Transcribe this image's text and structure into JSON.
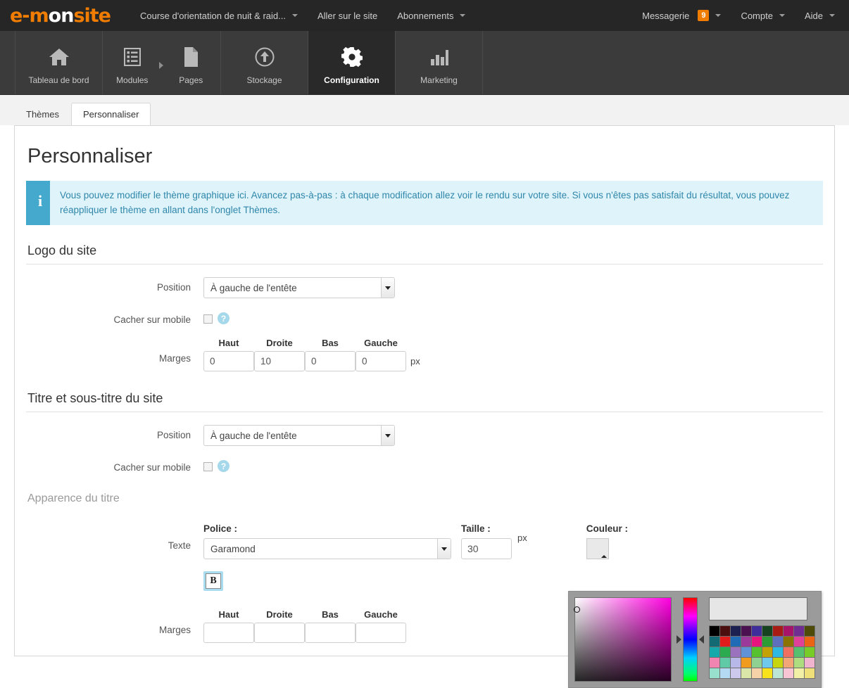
{
  "topbar": {
    "brand_part1": "e-m",
    "brand_part2": "on",
    "brand_part3": "site",
    "nav": [
      {
        "label": "Course d'orientation de nuit & raid...",
        "caret": true
      },
      {
        "label": "Aller sur le site",
        "caret": false
      },
      {
        "label": "Abonnements",
        "caret": true
      }
    ],
    "right": [
      {
        "label": "Messagerie",
        "badge": "9",
        "caret": true
      },
      {
        "label": "Compte",
        "badge": null,
        "caret": true
      },
      {
        "label": "Aide",
        "badge": null,
        "caret": true
      }
    ],
    "badge_color": "#f07d00"
  },
  "mainnav": {
    "items": [
      {
        "label": "Tableau de bord",
        "icon": "home-icon",
        "active": false
      },
      {
        "label": "Modules",
        "icon": "list-icon",
        "active": false
      },
      {
        "label": "Pages",
        "icon": "page-icon",
        "active": false
      },
      {
        "label": "Stockage",
        "icon": "upload-circle-icon",
        "active": false
      },
      {
        "label": "Configuration",
        "icon": "gear-icon",
        "active": true
      },
      {
        "label": "Marketing",
        "icon": "bar-chart-icon",
        "active": false
      }
    ]
  },
  "tabs": [
    {
      "label": "Thèmes",
      "active": false
    },
    {
      "label": "Personnaliser",
      "active": true
    }
  ],
  "page": {
    "title": "Personnaliser"
  },
  "alert": {
    "icon": "info-icon",
    "text": "Vous pouvez modifier le thème graphique ici. Avancez pas-à-pas : à chaque modification allez voir le rendu sur votre site. Si vous n'êtes pas satisfait du résultat, vous pouvez réappliquer le thème en allant dans l'onglet Thèmes.",
    "accent_color": "#44a9cc",
    "bg_color": "#dff3fb",
    "text_color": "#2f87ab"
  },
  "logo_section": {
    "title": "Logo du site",
    "position_label": "Position",
    "position_value": "À gauche de l'entête",
    "hide_mobile_label": "Cacher sur mobile",
    "hide_mobile_checked": false,
    "help_glyph": "?",
    "margins_label": "Marges",
    "margin_heads": [
      "Haut",
      "Droite",
      "Bas",
      "Gauche"
    ],
    "margin_values": [
      "0",
      "10",
      "0",
      "0"
    ],
    "unit": "px"
  },
  "title_section": {
    "title": "Titre et sous-titre du site",
    "position_label": "Position",
    "position_value": "À gauche de l'entête",
    "hide_mobile_label": "Cacher sur mobile",
    "hide_mobile_checked": false,
    "help_glyph": "?"
  },
  "appearance_section": {
    "title": "Apparence du titre",
    "texte_label": "Texte",
    "police_label": "Police :",
    "police_value": "Garamond",
    "taille_label": "Taille :",
    "taille_value": "30",
    "unit": "px",
    "couleur_label": "Couleur :",
    "bold_label": "B",
    "bold_active": true,
    "margins_label": "Marges",
    "margin_heads": [
      "Haut",
      "Droite",
      "Bas",
      "Gauche"
    ],
    "margin_values": [
      "",
      "",
      "",
      ""
    ]
  },
  "color_picker": {
    "swatch_color": "#e9e9e9",
    "preview_color": "#e6e6e6",
    "palette": [
      "#000000",
      "#4a0e0e",
      "#1b2050",
      "#4b1050",
      "#3e2d9a",
      "#15421f",
      "#a81a14",
      "#a8136a",
      "#6f2c91",
      "#4e4a08",
      "#136a72",
      "#e01b1b",
      "#1f6bb5",
      "#9b3a9b",
      "#e5147e",
      "#2f9b35",
      "#5f6fc0",
      "#8c7300",
      "#e0409a",
      "#ea6414",
      "#16a9ac",
      "#2bab4f",
      "#9b72bd",
      "#5f92d6",
      "#56c12e",
      "#c2a206",
      "#2fb8e0",
      "#ef6f61",
      "#55c06e",
      "#78cc28",
      "#ef85b0",
      "#60c9a5",
      "#b8b8e8",
      "#f09b1e",
      "#90d091",
      "#6fc9ec",
      "#c7d410",
      "#f2a678",
      "#aedd7f",
      "#f0b4cf",
      "#98e0cd",
      "#b4d9f2",
      "#ccc9ec",
      "#d9e6a8",
      "#f5d2a8",
      "#f7e21c",
      "#bde5d4",
      "#f7c5d4",
      "#f2f0a6",
      "#f0e07a"
    ]
  }
}
